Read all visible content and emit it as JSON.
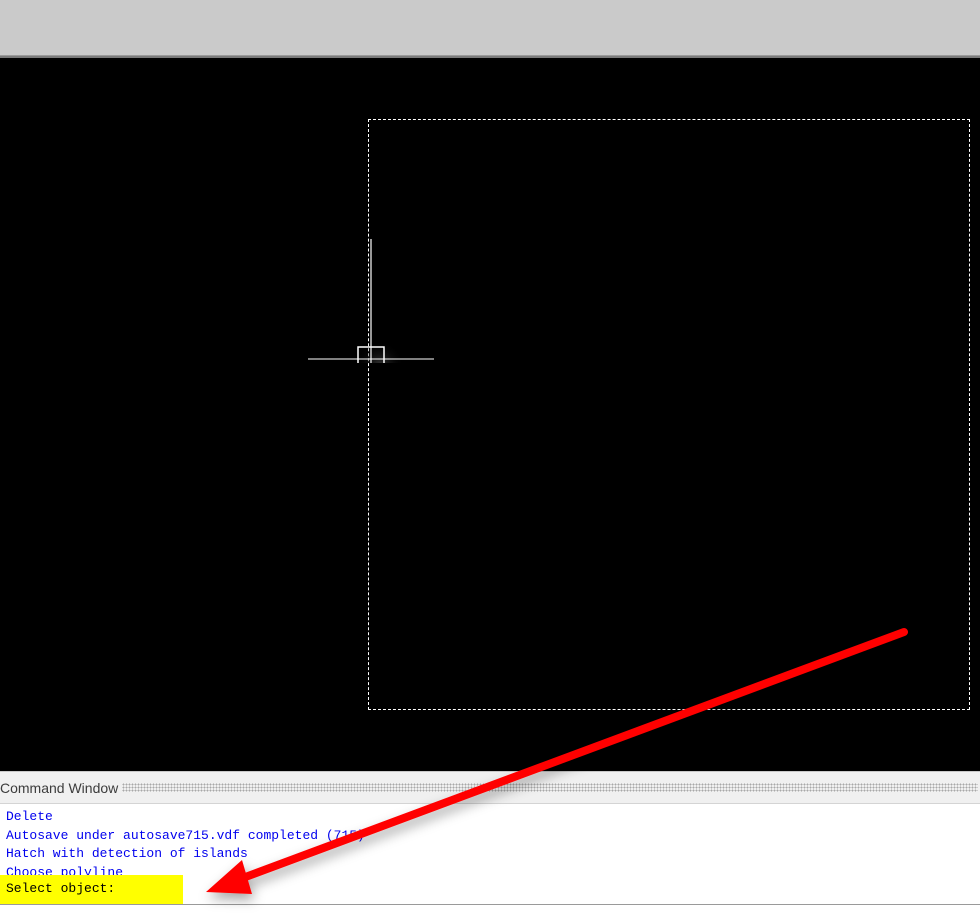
{
  "command_window": {
    "title": "Command Window",
    "log_lines": [
      "Delete",
      "Autosave under autosave715.vdf completed (715)",
      "Hatch with detection of islands",
      "Choose polyline"
    ],
    "prompt": "Select object:"
  },
  "colors": {
    "canvas_background": "#000000",
    "log_text": "#0000ee",
    "prompt_highlight": "#ffff00",
    "annotation_arrow": "#ff0000"
  },
  "icons": {
    "cursor": "crosshair-pickbox-icon",
    "annotation": "red-arrow-icon"
  }
}
